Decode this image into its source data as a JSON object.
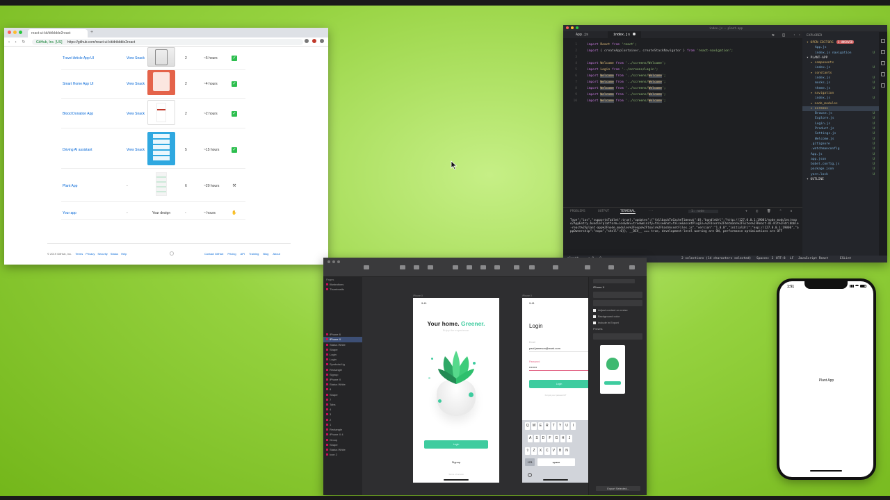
{
  "browser": {
    "tab_title": "react-ui-kit/dribbble2react",
    "new_tab": "+",
    "nav_icons": "‹ › ↻",
    "url_secure": "GitHub, Inc. [US]",
    "url": "https://github.com/react-ui-kit/dribbble2react",
    "rows": [
      {
        "name": "Travel Article App UI",
        "link": "View Snack",
        "screens": "2",
        "hours": "~5 hours",
        "status": "✓",
        "thumb": "th-travel"
      },
      {
        "name": "Smart Home App UI",
        "link": "View Snack",
        "screens": "2",
        "hours": "~4 hours",
        "status": "✓",
        "thumb": "th-smart"
      },
      {
        "name": "Blood Donation App",
        "link": "View Snack",
        "screens": "2",
        "hours": "~2 hours",
        "status": "✓",
        "thumb": "th-blood"
      },
      {
        "name": "Driving AI assistant",
        "link": "View Snack",
        "screens": "5",
        "hours": "~15 hours",
        "status": "✓",
        "thumb": "th-drive"
      },
      {
        "name": "Plant App",
        "link": "-",
        "screens": "6",
        "hours": "~20 hours",
        "status": "⚒",
        "thumb": "th-plant"
      },
      {
        "name": "Your app",
        "link": "-",
        "screens": "-",
        "hours": "~ hours",
        "status": "✋",
        "thumb": "design",
        "design": "Your design"
      }
    ],
    "footer": {
      "copyright": "© 2019 GitHub, Inc.",
      "left_links": [
        "Terms",
        "Privacy",
        "Security",
        "Status",
        "Help"
      ],
      "right_links": [
        "Contact GitHub",
        "Pricing",
        "API",
        "Training",
        "Blog",
        "About"
      ]
    }
  },
  "vscode": {
    "window_title": "index.js — plant-app",
    "tabs": [
      "App.js",
      "index.js"
    ],
    "code_lines": [
      [
        {
          "t": "import ",
          "c": "kw"
        },
        {
          "t": "React ",
          "c": "id"
        },
        {
          "t": "from ",
          "c": "kw"
        },
        {
          "t": "'react';",
          "c": "str"
        }
      ],
      [
        {
          "t": "import ",
          "c": "kw"
        },
        {
          "t": "{ createAppContainer, createStackNavigator } ",
          "c": "pl"
        },
        {
          "t": "from ",
          "c": "kw"
        },
        {
          "t": "'react-navigation';",
          "c": "str"
        }
      ],
      [],
      [
        {
          "t": "import ",
          "c": "kw"
        },
        {
          "t": "Welcome ",
          "c": "id"
        },
        {
          "t": "from ",
          "c": "kw"
        },
        {
          "t": "'../screens/Welcome';",
          "c": "str"
        }
      ],
      [
        {
          "t": "import ",
          "c": "kw"
        },
        {
          "t": "Login ",
          "c": "id"
        },
        {
          "t": "from ",
          "c": "kw"
        },
        {
          "t": "'../screens/Login';",
          "c": "str"
        }
      ],
      [
        {
          "t": "import ",
          "c": "kw"
        },
        {
          "t": "Welcome",
          "c": "hl"
        },
        {
          "t": " from ",
          "c": "kw"
        },
        {
          "t": "'../screens/",
          "c": "str"
        },
        {
          "t": "Welcome",
          "c": "hl"
        },
        {
          "t": "';",
          "c": "str"
        }
      ],
      [
        {
          "t": "import ",
          "c": "kw"
        },
        {
          "t": "Welcome",
          "c": "hl"
        },
        {
          "t": " from ",
          "c": "kw"
        },
        {
          "t": "'../screens/",
          "c": "str"
        },
        {
          "t": "Welcome",
          "c": "hl"
        },
        {
          "t": "';",
          "c": "str"
        }
      ],
      [
        {
          "t": "import ",
          "c": "kw"
        },
        {
          "t": "Welcome",
          "c": "hl"
        },
        {
          "t": " from ",
          "c": "kw"
        },
        {
          "t": "'../screens/",
          "c": "str"
        },
        {
          "t": "Welcome",
          "c": "hl"
        },
        {
          "t": "';",
          "c": "str"
        }
      ],
      [
        {
          "t": "import ",
          "c": "kw"
        },
        {
          "t": "Welcome",
          "c": "hl"
        },
        {
          "t": " from ",
          "c": "kw"
        },
        {
          "t": "'../screens/",
          "c": "str"
        },
        {
          "t": "Welcome",
          "c": "hl"
        },
        {
          "t": "';",
          "c": "str"
        }
      ],
      [
        {
          "t": "import ",
          "c": "kw"
        },
        {
          "t": "Welcome",
          "c": "hl"
        },
        {
          "t": " from ",
          "c": "kw"
        },
        {
          "t": "'../screens/",
          "c": "str"
        },
        {
          "t": "Welcome",
          "c": "hl"
        },
        {
          "t": "';",
          "c": "str"
        }
      ]
    ],
    "explorer": {
      "header": "EXPLORER",
      "open_editors": "OPEN EDITORS",
      "unsaved": "1 UNSAVED",
      "items": [
        {
          "label": "App.js",
          "kind": "file",
          "indent": 2,
          "u": ""
        },
        {
          "label": "index.js  navigation",
          "kind": "file",
          "indent": 2,
          "u": "U"
        },
        {
          "label": "PLANT-APP",
          "kind": "head",
          "indent": 0,
          "u": ""
        },
        {
          "label": "components",
          "kind": "folder",
          "indent": 1,
          "u": ""
        },
        {
          "label": "index.js",
          "kind": "file",
          "indent": 2,
          "u": "U"
        },
        {
          "label": "constants",
          "kind": "folder",
          "indent": 1,
          "u": ""
        },
        {
          "label": "index.js",
          "kind": "file",
          "indent": 2,
          "u": "U"
        },
        {
          "label": "mocks.js",
          "kind": "file",
          "indent": 2,
          "u": "U"
        },
        {
          "label": "theme.js",
          "kind": "file",
          "indent": 2,
          "u": "U"
        },
        {
          "label": "navigation",
          "kind": "folder",
          "indent": 1,
          "u": ""
        },
        {
          "label": "index.js",
          "kind": "file",
          "indent": 2,
          "u": "U"
        },
        {
          "label": "node_modules",
          "kind": "folder",
          "indent": 1,
          "u": ""
        },
        {
          "label": "screens",
          "kind": "folder",
          "indent": 1,
          "u": "",
          "sel": true
        },
        {
          "label": "Browse.js",
          "kind": "file",
          "indent": 2,
          "u": "U"
        },
        {
          "label": "Explore.js",
          "kind": "file",
          "indent": 2,
          "u": "U"
        },
        {
          "label": "Login.js",
          "kind": "file",
          "indent": 2,
          "u": "U"
        },
        {
          "label": "Product.js",
          "kind": "file",
          "indent": 2,
          "u": "U"
        },
        {
          "label": "Settings.js",
          "kind": "file",
          "indent": 2,
          "u": "U"
        },
        {
          "label": "Welcome.js",
          "kind": "file",
          "indent": 2,
          "u": "U"
        },
        {
          "label": ".gitignore",
          "kind": "file",
          "indent": 1,
          "u": "U"
        },
        {
          "label": ".watchmanconfig",
          "kind": "file",
          "indent": 1,
          "u": "U"
        },
        {
          "label": "App.js",
          "kind": "file",
          "indent": 1,
          "u": "U"
        },
        {
          "label": "app.json",
          "kind": "file",
          "indent": 1,
          "u": "U"
        },
        {
          "label": "babel.config.js",
          "kind": "file",
          "indent": 1,
          "u": "U"
        },
        {
          "label": "package.json",
          "kind": "file",
          "indent": 1,
          "u": "U"
        },
        {
          "label": "yarn.lock",
          "kind": "file",
          "indent": 1,
          "u": "U"
        },
        {
          "label": "OUTLINE",
          "kind": "head",
          "indent": 0,
          "u": ""
        }
      ]
    },
    "panel_tabs": [
      "PROBLEMS",
      "OUTPUT",
      "TERMINAL",
      "···"
    ],
    "terminal_select": "1: node",
    "terminal_text": "Type\":\"ios\",\"supportsTablet\":true},\"updates\":{\"fallbackToCacheTimeout\":0},\"bundleUrl\":\"http://127.0.0.1:19001/node_modules/expo/AppEntry.bundle?platform=ios&dev=true&minify=false&hot=false&assetPlugin=%2FUsers%2Fhetmann%2FSites%2FReact-UI-Kit%2Fdribbble-react%2Fplant-app%2Fnode_modules%2Fexpo%2Ftools%2FhashAssetFiles.js\",\"version\":\"1.0.0\",\"initialUri\":\"exp://127.0.0.1:19000\",\"appOwnership\":\"expo\",\"shell\":0}}, __DEV__ === true, development-level warning are ON, performance optimizations are OFF",
    "status": {
      "branch": "plant*",
      "errors": "⊗ 0 ⚠ 0",
      "selection": "2 selections (14 characters selected)",
      "spaces": "Spaces: 2",
      "encoding": "UTF-8",
      "eol": "LF",
      "language": "JavaScript React",
      "lint": "ESLint"
    }
  },
  "sketch": {
    "pages_label": "Pages",
    "layers": [
      "Illustrations",
      "Thumbnails",
      "",
      "",
      "",
      "",
      "",
      "",
      "",
      "",
      "iPhone 8",
      "iPhone X",
      "Status White",
      "Shape",
      "Login",
      "Login",
      "Symbols/Lig",
      "Rectangle",
      "Signup",
      "iPhone X",
      "Status White",
      "8",
      "Shape",
      "7",
      "Tabs",
      "4",
      "3",
      "2",
      "1",
      "Rectangle",
      "iPhone X 4",
      "Group",
      "Shape",
      "Status White",
      "Icon 2"
    ],
    "artboard1_label": "iPhone X",
    "artboard2_label": "iPhone X",
    "welcome": {
      "time": "9:41",
      "title_black": "Your home.",
      "title_green": "Greener.",
      "subtitle": "Enjoy the experience.",
      "login_button": "Login",
      "signup": "Signup",
      "terms": "Terms of service"
    },
    "login": {
      "time": "9:41",
      "title": "Login",
      "email_label": "Email",
      "email_value": "paul.jameson@work.com",
      "password_label": "Password",
      "password_value": "••••••••",
      "button": "Login",
      "forgot": "Forgot your password?",
      "keys_row1": [
        "Q",
        "W",
        "E",
        "R",
        "T",
        "Y",
        "U",
        "I"
      ],
      "keys_row2": [
        "A",
        "S",
        "D",
        "F",
        "G",
        "H",
        "J"
      ],
      "keys_row3": [
        "⇧",
        "Z",
        "X",
        "C",
        "V",
        "B",
        "N"
      ],
      "key_123": "123",
      "key_space": "space"
    },
    "inspector": {
      "title": "iPhone X",
      "checks": [
        "Adjust content on resize",
        "Background color",
        "Include in Export"
      ],
      "presets": "Presets",
      "export_label": "Export Selected..."
    }
  },
  "simulator": {
    "time": "1:51",
    "text": "Plant App"
  },
  "colors": {
    "accent_green": "#3ecc9f",
    "link_blue": "#0366d6",
    "desktop": "#95d23f"
  }
}
